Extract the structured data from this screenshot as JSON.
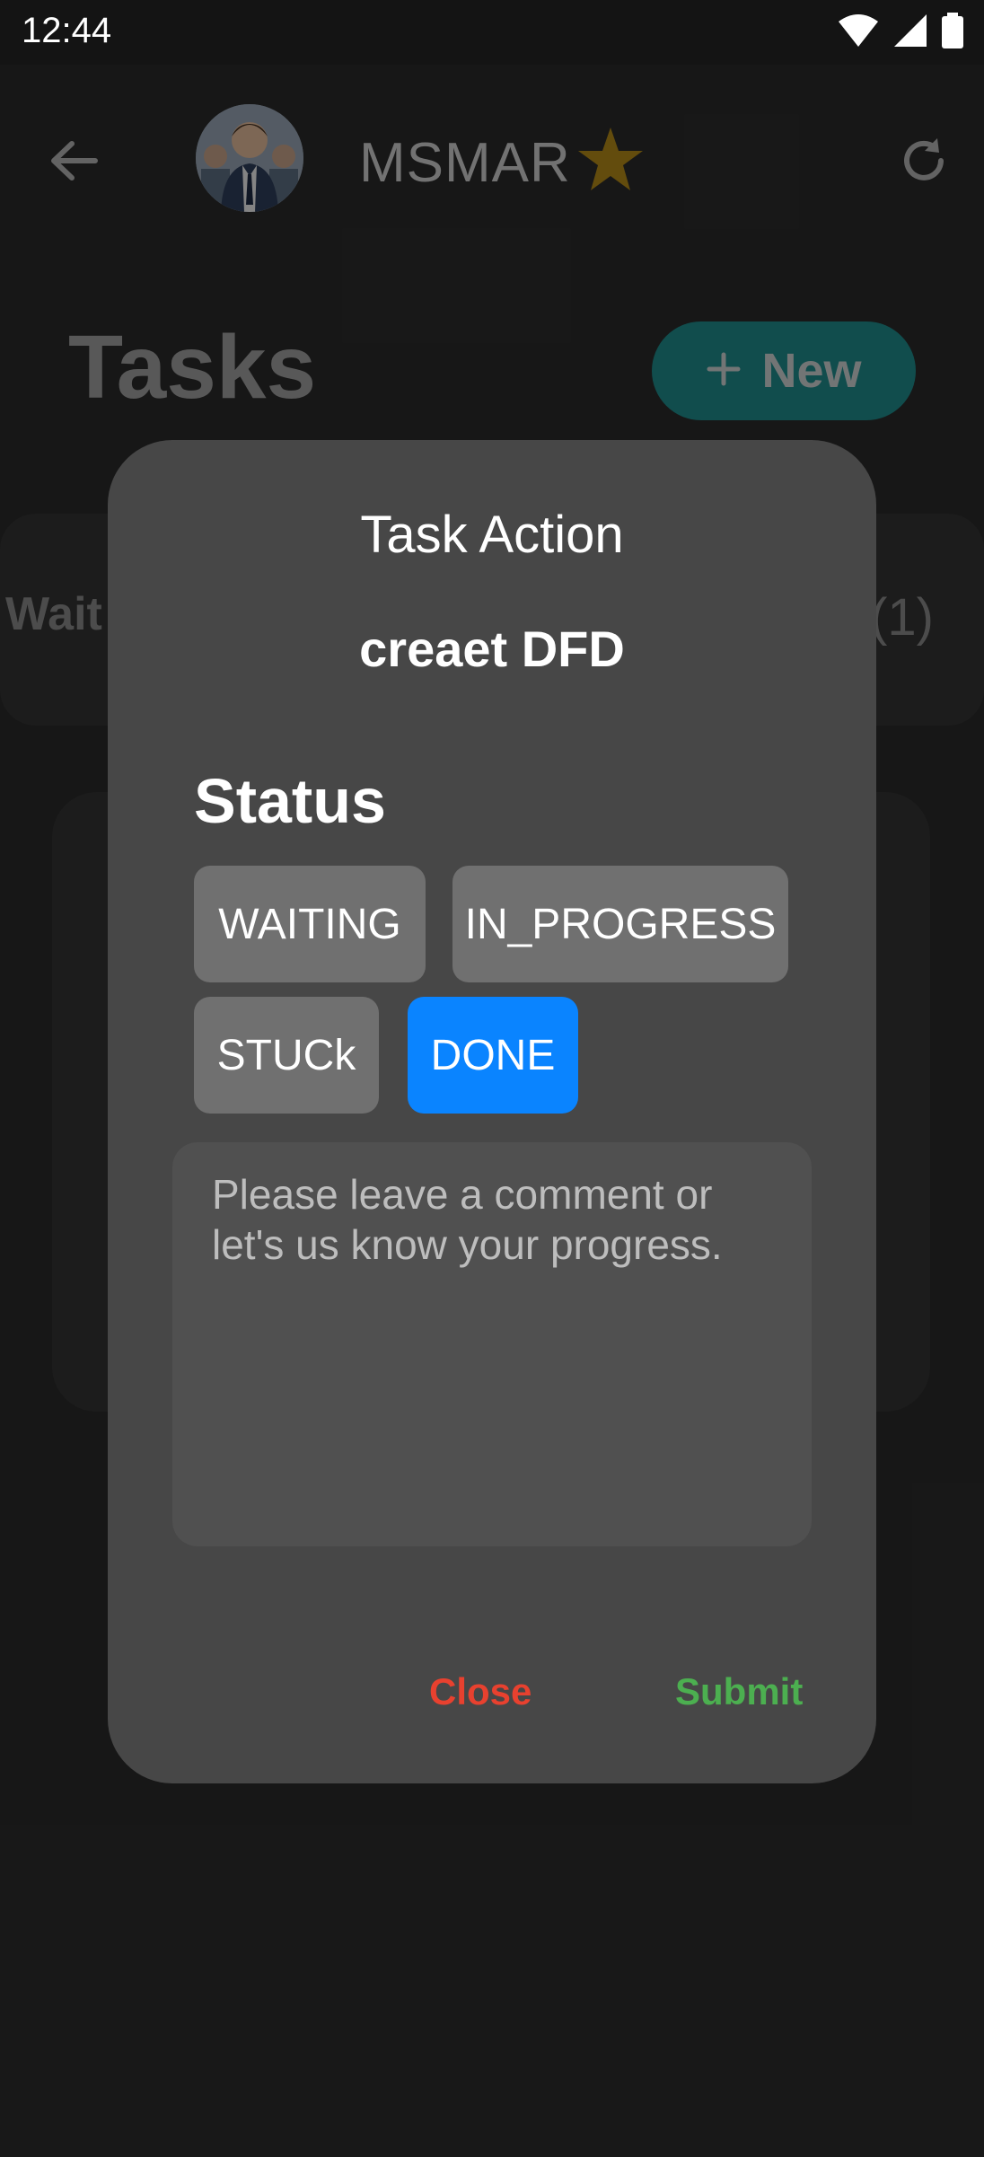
{
  "status_bar": {
    "time": "12:44",
    "icons": [
      "wifi-icon",
      "signal-icon",
      "battery-icon"
    ]
  },
  "header": {
    "back_icon": "arrow-left-icon",
    "user_name": "MSMAR",
    "badge_icon": "star-badge-icon",
    "refresh_icon": "refresh-icon"
  },
  "page": {
    "title": "Tasks",
    "new_button_label": "New",
    "new_button_icon": "plus-icon"
  },
  "tabs": {
    "left_partial": "Wait",
    "right_partial": "(1)"
  },
  "modal": {
    "title": "Task Action",
    "task_name": "creaet DFD",
    "status_label": "Status",
    "status_options": [
      {
        "label": "WAITING",
        "selected": false
      },
      {
        "label": "IN_PROGRESS",
        "selected": false
      },
      {
        "label": "STUCk",
        "selected": false
      },
      {
        "label": "DONE",
        "selected": true
      }
    ],
    "comment": {
      "value": "",
      "placeholder": "Please leave a comment or let's us know your progress."
    },
    "close_label": "Close",
    "submit_label": "Submit"
  },
  "colors": {
    "selected_chip": "#0a84ff",
    "close": "#e8412f",
    "submit": "#4caf50",
    "new_button": "#1f8c8d"
  }
}
